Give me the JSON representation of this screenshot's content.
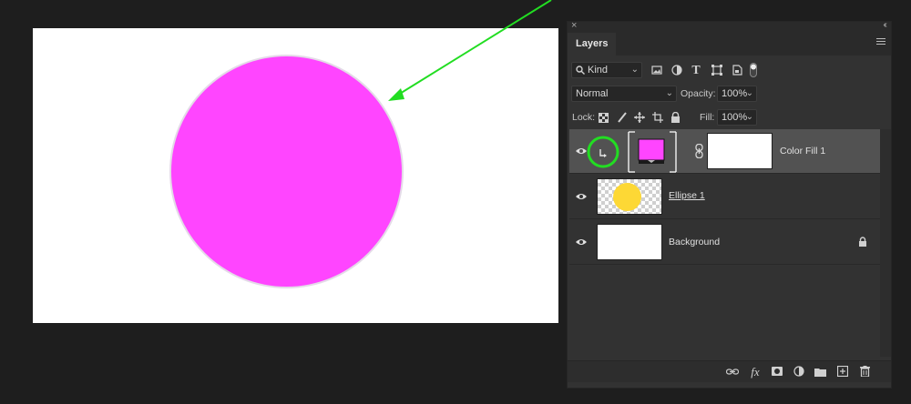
{
  "canvas": {
    "shape_color": "#ff45ff",
    "arrow_color": "#22dd22"
  },
  "panel": {
    "close_glyph": "×",
    "collapse_glyph": "‹‹",
    "tab_title": "Layers",
    "filter": {
      "value": "Kind",
      "icons": [
        "image-filter-icon",
        "adjustment-filter-icon",
        "type-filter-icon",
        "shape-filter-icon",
        "smartobject-filter-icon",
        "filter-toggle-icon"
      ]
    },
    "blend_mode": "Normal",
    "opacity_label": "Opacity:",
    "opacity_value": "100%",
    "lock_label": "Lock:",
    "fill_label": "Fill:",
    "fill_value": "100%",
    "layers": [
      {
        "name": "Color Fill 1",
        "selected": true,
        "fill_color": "#ff45ff",
        "highlight_color": "#22dd22"
      },
      {
        "name": "Ellipse 1",
        "underlined": true,
        "ellipse_color": "#fdd835"
      },
      {
        "name": "Background",
        "locked": true
      }
    ]
  }
}
